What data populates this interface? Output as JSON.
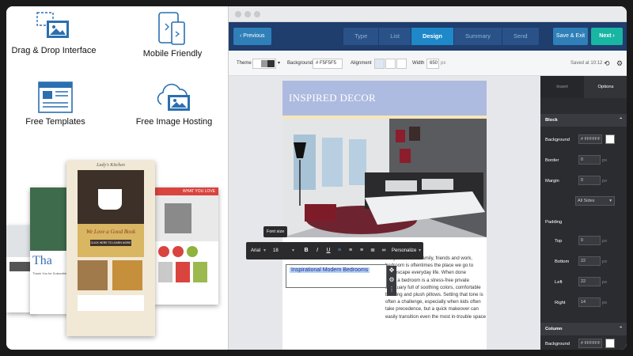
{
  "features": [
    {
      "label": "Drag & Drop Interface",
      "icon": "drag-drop-image-icon"
    },
    {
      "label": "Mobile Friendly",
      "icon": "mobile-devices-icon"
    },
    {
      "label": "Free Templates",
      "icon": "template-grid-icon"
    },
    {
      "label": "Free Image Hosting",
      "icon": "cloud-image-icon"
    }
  ],
  "mockup": {
    "header_text": "Lady's Kitchen",
    "headline": "We Love a Good Book",
    "cta": "CLICK HERE TO LEARN MORE",
    "banner": "WHAT YOU LOVE",
    "side_text": "Tha",
    "footer_text": "Thank You for Subscribing"
  },
  "navbar": {
    "prev_label": "Previous",
    "steps": [
      "Type",
      "List",
      "Design",
      "Summary",
      "Send"
    ],
    "active_step": "Design",
    "save_label": "Save & Exit",
    "next_label": "Next"
  },
  "toolbar": {
    "theme_label": "Theme",
    "background_label": "Background",
    "background_value": "# F5F5F5",
    "alignment_label": "Alignment",
    "width_label": "Width",
    "width_value": "650",
    "width_unit": "px",
    "saved_text": "Saved at 10:12"
  },
  "email": {
    "header_title": "INSPIRED DECOR",
    "selected_heading": "Inspirational Modern Bedrooms",
    "body_lines": [
      "busy lives full of family, friends and work,",
      "bedroom is oftentimes the place we go to",
      "and escape everyday life. When done",
      "right, a bedroom is a stress-free private",
      "sanctuary full of soothing colors, comfortable",
      "bedding and plush pillows. Setting that tone is",
      "often a challenge, especially when kids often",
      "take precedence, but a quick makeover can",
      "easily transition even the most in-trouble space"
    ]
  },
  "format_bar": {
    "tooltip": "Font size",
    "font": "Arial",
    "size": "18",
    "bold": "B",
    "italic": "I",
    "underline": "U",
    "personalize": "Personalize"
  },
  "side_panel": {
    "tabs": [
      "Insert",
      "Options"
    ],
    "active_tab": "Options",
    "block_label": "Block",
    "background_label": "Background",
    "background_value": "# FFFFFF",
    "border_label": "Border",
    "border_value": "0",
    "margin_label": "Margin",
    "margin_value": "0",
    "sides_value": "All Sides",
    "padding_label": "Padding",
    "unit": "px",
    "padding": [
      {
        "label": "Top",
        "value": "0"
      },
      {
        "label": "Bottom",
        "value": "22"
      },
      {
        "label": "Left",
        "value": "22"
      },
      {
        "label": "Right",
        "value": "14"
      }
    ],
    "column_label": "Column",
    "column_background_label": "Background",
    "column_background_value": "# FFFFFF"
  },
  "colors": {
    "navbar": "#1f3d6d",
    "active_step": "#1e88c9",
    "next_button": "#18b6a3",
    "email_header": "#aebbe0",
    "side_panel": "#2b2c30"
  }
}
